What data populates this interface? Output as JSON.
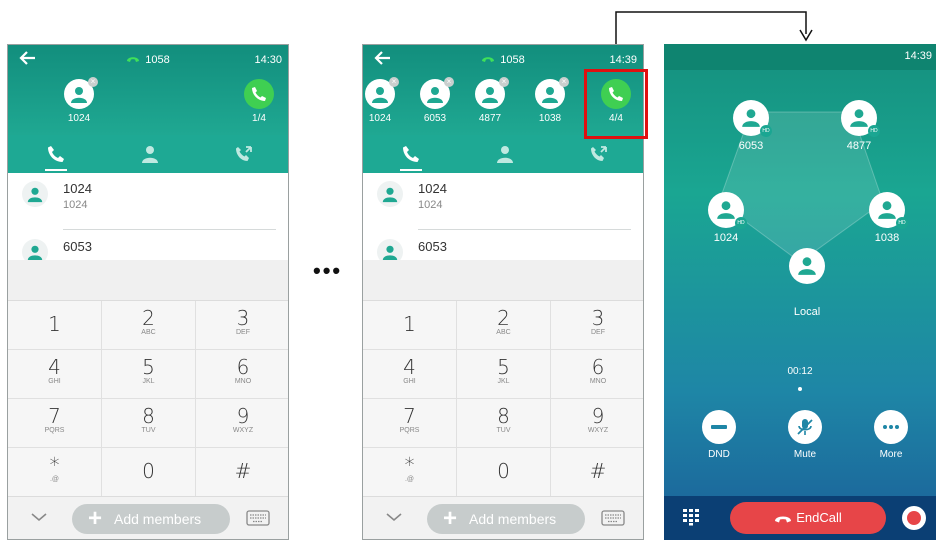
{
  "phone1": {
    "status_number": "1058",
    "clock": "14:30",
    "participants": [
      {
        "name": "1024"
      }
    ],
    "call_counter": "1/4",
    "contacts": [
      {
        "name": "1024",
        "number": "1024"
      },
      {
        "name": "6053",
        "number": ""
      }
    ],
    "add_members_label": "Add members"
  },
  "phone2": {
    "status_number": "1058",
    "clock": "14:39",
    "participants": [
      {
        "name": "1024"
      },
      {
        "name": "6053"
      },
      {
        "name": "4877"
      },
      {
        "name": "1038"
      }
    ],
    "call_counter": "4/4",
    "contacts": [
      {
        "name": "1024",
        "number": "1024"
      },
      {
        "name": "6053",
        "number": ""
      }
    ],
    "add_members_label": "Add members"
  },
  "keypad": [
    {
      "digit": "1",
      "letters": ""
    },
    {
      "digit": "2",
      "letters": "ABC"
    },
    {
      "digit": "3",
      "letters": "DEF"
    },
    {
      "digit": "4",
      "letters": "GHI"
    },
    {
      "digit": "5",
      "letters": "JKL"
    },
    {
      "digit": "6",
      "letters": "MNO"
    },
    {
      "digit": "7",
      "letters": "PQRS"
    },
    {
      "digit": "8",
      "letters": "TUV"
    },
    {
      "digit": "9",
      "letters": "WXYZ"
    },
    {
      "digit": "*",
      "letters": ".@"
    },
    {
      "digit": "0",
      "letters": ""
    },
    {
      "digit": "#",
      "letters": ""
    }
  ],
  "ellipsis": "•••",
  "conference": {
    "clock": "14:39",
    "members": [
      {
        "name": "6053",
        "hd": "HD"
      },
      {
        "name": "4877",
        "hd": "HD"
      },
      {
        "name": "1024",
        "hd": "HD"
      },
      {
        "name": "1038",
        "hd": "HD"
      },
      {
        "name": "Local",
        "hd": ""
      }
    ],
    "timer": "00:12",
    "controls": [
      {
        "label": "DND",
        "icon": "dnd-icon"
      },
      {
        "label": "Mute",
        "icon": "mute-icon"
      },
      {
        "label": "More",
        "icon": "more-icon"
      }
    ],
    "end_call_label": "EndCall"
  },
  "colors": {
    "teal": "#1fa892",
    "green_call": "#3fcf52",
    "highlight": "#e01010",
    "end_call": "#e74548"
  }
}
